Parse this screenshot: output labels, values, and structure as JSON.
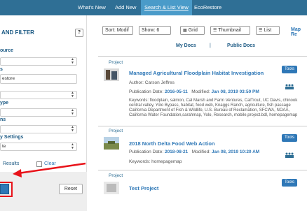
{
  "nav": {
    "items": [
      "What's New",
      "Add New",
      "Search & List View",
      "EcoRestore"
    ]
  },
  "left_panel": {
    "title": "AND FILTER",
    "help_label": "?",
    "source_label": "ource",
    "source_value": "",
    "field_label": "s",
    "field_value": "estore",
    "third_value": "",
    "type_label": "ype",
    "type_value": "",
    "ns_label": "ns",
    "ns_value": "",
    "settings_label": "y Settings",
    "settings_value": "te",
    "results_label": "Results",
    "clear_label": "Clear",
    "reset_label": "Reset"
  },
  "toolbar": {
    "sort_label": "Sort: Modif",
    "show_label": "Show: 6",
    "grid_label": "Grid",
    "thumbnail_label": "Thumbnail",
    "list_label": "List",
    "map_label": "Map Re"
  },
  "doc_tabs": {
    "my_docs": "My Docs",
    "divider": "|",
    "public_docs": "Public Docs"
  },
  "results": [
    {
      "type": "Project",
      "title": "Managed Agricultural Floodplain Habitat Investigation",
      "author": "Author: Carson Jeffres",
      "pub_label": "Publication Date:",
      "pub_date": "2016-05-11",
      "mod_label": "Modified:",
      "mod_date": "Jan 08, 2019 03:50 PM",
      "keywords": "Keywords: floodplain, salmon, Cal Marsh and Farm Ventures, CalTrout, UC Davis, chinook central valley, Yolo Bypass, habitat, food web, Knaggs Ranch, agriculture, fish passage California Department of Fish & Wildlife, U.S. Bureau of Reclamation, SFCWA, NOAA, California Water Foundation,sarahmap, Yolo, Research, mobile,project.bdl, homepagemap",
      "tools": "Tools"
    },
    {
      "type": "Project",
      "title": "2018 North Delta Food Web Action",
      "pub_label": "Publication Date:",
      "pub_date": "2018-08-21",
      "mod_label": "Modified:",
      "mod_date": "Jan 08, 2019 10:20 AM",
      "keywords": "Keywords: homepagemap",
      "tools": "Tools"
    },
    {
      "type": "Project",
      "title": "Test Project",
      "tools": "Tools"
    }
  ],
  "colors": {
    "nav_bg": "#2f6f95",
    "nav_active": "#4a9bc9",
    "link": "#2f78b7",
    "annotation": "#e8131a"
  }
}
